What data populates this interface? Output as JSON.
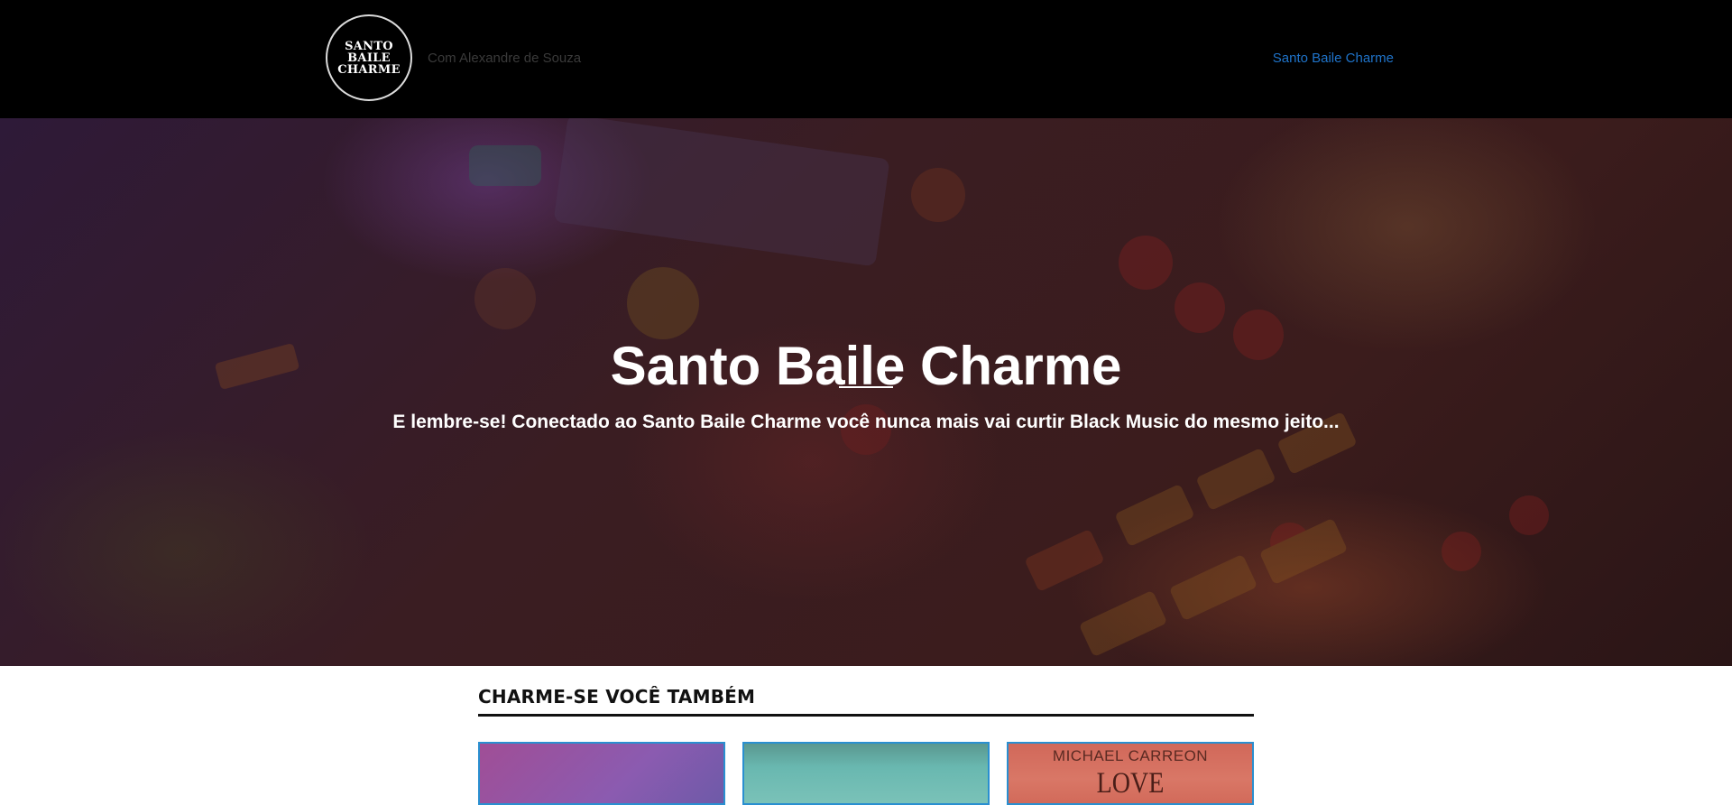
{
  "header": {
    "logo_lines": [
      "SANTO",
      "BAILE",
      "CHARME"
    ],
    "tagline": "Com Alexandre de Souza",
    "nav_link": "Santo Baile Charme"
  },
  "hero": {
    "title": "Santo Baile Charme",
    "subtitle": "E lembre-se! Conectado ao Santo Baile Charme você nunca mais vai curtir Black Music do mesmo jeito..."
  },
  "section": {
    "title": "CHARME-SE VOCÊ TAMBÉM",
    "cards": [
      {
        "artist": "",
        "album": ""
      },
      {
        "artist": "",
        "album": ""
      },
      {
        "artist": "MICHAEL CARREON",
        "album": "LOVE ADOLESCENT"
      }
    ]
  },
  "colors": {
    "header_bg": "#000000",
    "nav_link": "#1f73c9",
    "card_border": "#2a8fd0"
  }
}
